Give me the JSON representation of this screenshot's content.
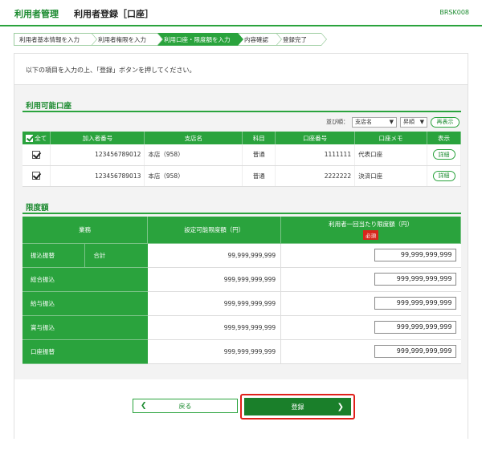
{
  "header": {
    "app_name": "利用者管理",
    "page_title": "利用者登録［口座］",
    "screen_code": "BRSK008"
  },
  "steps": [
    "利用者基本情報を入力",
    "利用者権限を入力",
    "利用口座・限度額を入力",
    "内容確認",
    "登録完了"
  ],
  "notice": "以下の項目を入力の上、「登録」ボタンを押してください。",
  "accounts": {
    "title": "利用可能口座",
    "sort_label": "並び順：",
    "sort_key": "支店名",
    "sort_order": "昇順",
    "redisplay": "再表示",
    "columns": [
      "全て",
      "加入者番号",
      "支店名",
      "科目",
      "口座番号",
      "口座メモ",
      "表示"
    ],
    "rows": [
      {
        "subscriber": "123456789012",
        "branch": "本店（958）",
        "type": "普通",
        "number": "1111111",
        "memo": "代表口座",
        "detail": "詳細"
      },
      {
        "subscriber": "123456789013",
        "branch": "本店（958）",
        "type": "普通",
        "number": "2222222",
        "memo": "決済口座",
        "detail": "詳細"
      }
    ]
  },
  "limits": {
    "title": "限度額",
    "columns": {
      "business": "業務",
      "settable": "設定可能限度額（円）",
      "per_user": "利用者一回当たり限度額（円）",
      "required": "必須"
    },
    "rows": [
      {
        "name": "振込振替",
        "sub": "合計",
        "max": "99,999,999,999",
        "input": "99,999,999,999"
      },
      {
        "name": "総合振込",
        "sub": "",
        "max": "999,999,999,999",
        "input": "999,999,999,999"
      },
      {
        "name": "給与振込",
        "sub": "",
        "max": "999,999,999,999",
        "input": "999,999,999,999"
      },
      {
        "name": "賞与振込",
        "sub": "",
        "max": "999,999,999,999",
        "input": "999,999,999,999"
      },
      {
        "name": "口座振替",
        "sub": "",
        "max": "999,999,999,999",
        "input": "999,999,999,999"
      }
    ]
  },
  "buttons": {
    "back": "戻る",
    "submit": "登録"
  },
  "colors": {
    "primary": "#2aa33d",
    "dark": "#1a7f2a",
    "highlight": "#e0201a"
  }
}
